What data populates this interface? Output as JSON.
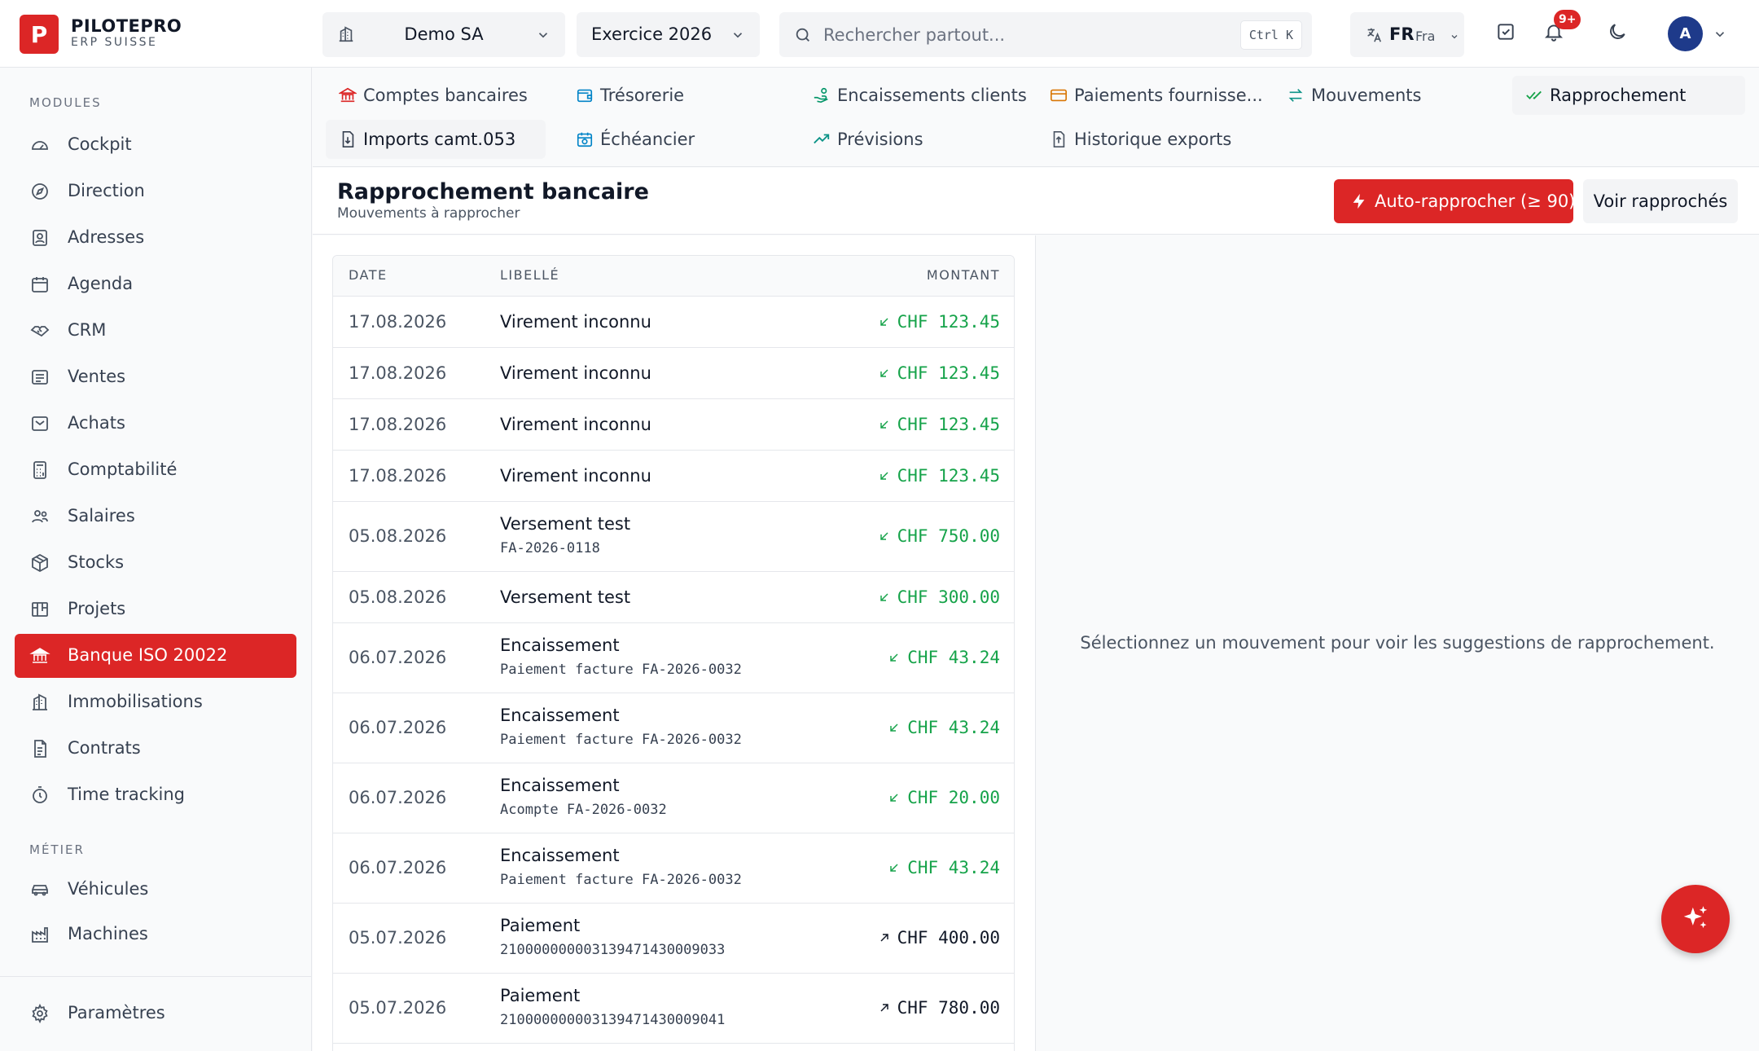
{
  "brand": {
    "mark": "P",
    "name": "PILOTEPRO",
    "subtitle": "ERP SUISSE"
  },
  "topbar": {
    "company": "Demo SA",
    "year": "Exercice 2026",
    "search_placeholder": "Rechercher partout...",
    "search_shortcut": "Ctrl K",
    "lang_code": "FR",
    "lang_name": "Fra",
    "notifications_badge": "9+",
    "avatar_initial": "A"
  },
  "sidebar": {
    "section_modules": "MODULES",
    "section_metier": "MÉTIER",
    "items": [
      {
        "label": "Cockpit",
        "icon": "gauge-icon"
      },
      {
        "label": "Direction",
        "icon": "compass-icon"
      },
      {
        "label": "Adresses",
        "icon": "contact-icon"
      },
      {
        "label": "Agenda",
        "icon": "calendar-icon"
      },
      {
        "label": "CRM",
        "icon": "handshake-icon"
      },
      {
        "label": "Ventes",
        "icon": "receipt-icon"
      },
      {
        "label": "Achats",
        "icon": "inbox-icon"
      },
      {
        "label": "Comptabilité",
        "icon": "calculator-icon"
      },
      {
        "label": "Salaires",
        "icon": "users-icon"
      },
      {
        "label": "Stocks",
        "icon": "package-icon"
      },
      {
        "label": "Projets",
        "icon": "kanban-icon"
      },
      {
        "label": "Banque ISO 20022",
        "icon": "bank-icon",
        "active": true
      },
      {
        "label": "Immobilisations",
        "icon": "building-icon"
      },
      {
        "label": "Contrats",
        "icon": "file-contract-icon"
      },
      {
        "label": "Time tracking",
        "icon": "stopwatch-icon"
      }
    ],
    "metier_items": [
      {
        "label": "Véhicules",
        "icon": "car-icon"
      },
      {
        "label": "Machines",
        "icon": "factory-icon"
      }
    ],
    "settings_label": "Paramètres"
  },
  "subnav": {
    "tabs": [
      {
        "label": "Comptes bancaires",
        "icon": "bank-icon",
        "color": "#dc2626"
      },
      {
        "label": "Trésorerie",
        "icon": "wallet-icon",
        "color": "#0284c7"
      },
      {
        "label": "Encaissements clients",
        "icon": "hand-coins-icon",
        "color": "#059669"
      },
      {
        "label": "Paiements fournisse...",
        "icon": "credit-card-icon",
        "color": "#d97706"
      },
      {
        "label": "Mouvements",
        "icon": "arrows-exchange-icon",
        "color": "#0d9488"
      },
      {
        "label": "Rapprochement",
        "icon": "check-check-icon",
        "color": "#16a34a",
        "active": true
      },
      {
        "label": "Imports camt.053",
        "icon": "file-import-icon",
        "color": "#374151",
        "active": true
      },
      {
        "label": "Échéancier",
        "icon": "calendar-clock-icon",
        "color": "#0284c7"
      },
      {
        "label": "Prévisions",
        "icon": "trending-up-icon",
        "color": "#0d9488"
      },
      {
        "label": "Historique exports",
        "icon": "file-export-icon",
        "color": "#4b5563"
      }
    ]
  },
  "page": {
    "title": "Rapprochement bancaire",
    "subtitle": "Mouvements à rapprocher",
    "auto_button": "Auto-rapprocher (≥ 90)",
    "view_button": "Voir rapprochés",
    "empty_message": "Sélectionnez un mouvement pour voir les suggestions de rapprochement."
  },
  "table": {
    "headers": {
      "date": "DATE",
      "label": "LIBELLÉ",
      "amount": "MONTANT"
    },
    "rows": [
      {
        "date": "17.08.2026",
        "label": "Virement inconnu",
        "ref": "",
        "amount": "CHF 123.45",
        "direction": "in"
      },
      {
        "date": "17.08.2026",
        "label": "Virement inconnu",
        "ref": "",
        "amount": "CHF 123.45",
        "direction": "in"
      },
      {
        "date": "17.08.2026",
        "label": "Virement inconnu",
        "ref": "",
        "amount": "CHF 123.45",
        "direction": "in"
      },
      {
        "date": "17.08.2026",
        "label": "Virement inconnu",
        "ref": "",
        "amount": "CHF 123.45",
        "direction": "in"
      },
      {
        "date": "05.08.2026",
        "label": "Versement test",
        "ref": "FA-2026-0118",
        "amount": "CHF 750.00",
        "direction": "in"
      },
      {
        "date": "05.08.2026",
        "label": "Versement test",
        "ref": "",
        "amount": "CHF 300.00",
        "direction": "in"
      },
      {
        "date": "06.07.2026",
        "label": "Encaissement",
        "ref": "Paiement facture FA-2026-0032",
        "amount": "CHF 43.24",
        "direction": "in"
      },
      {
        "date": "06.07.2026",
        "label": "Encaissement",
        "ref": "Paiement facture FA-2026-0032",
        "amount": "CHF 43.24",
        "direction": "in"
      },
      {
        "date": "06.07.2026",
        "label": "Encaissement",
        "ref": "Acompte FA-2026-0032",
        "amount": "CHF 20.00",
        "direction": "in"
      },
      {
        "date": "06.07.2026",
        "label": "Encaissement",
        "ref": "Paiement facture FA-2026-0032",
        "amount": "CHF 43.24",
        "direction": "in"
      },
      {
        "date": "05.07.2026",
        "label": "Paiement",
        "ref": "210000000003139471430009033",
        "amount": "CHF 400.00",
        "direction": "out"
      },
      {
        "date": "05.07.2026",
        "label": "Paiement",
        "ref": "210000000003139471430009041",
        "amount": "CHF 780.00",
        "direction": "out"
      }
    ]
  },
  "colors": {
    "accent": "#dc2626",
    "incoming": "#16a34a",
    "outgoing": "#111827"
  }
}
